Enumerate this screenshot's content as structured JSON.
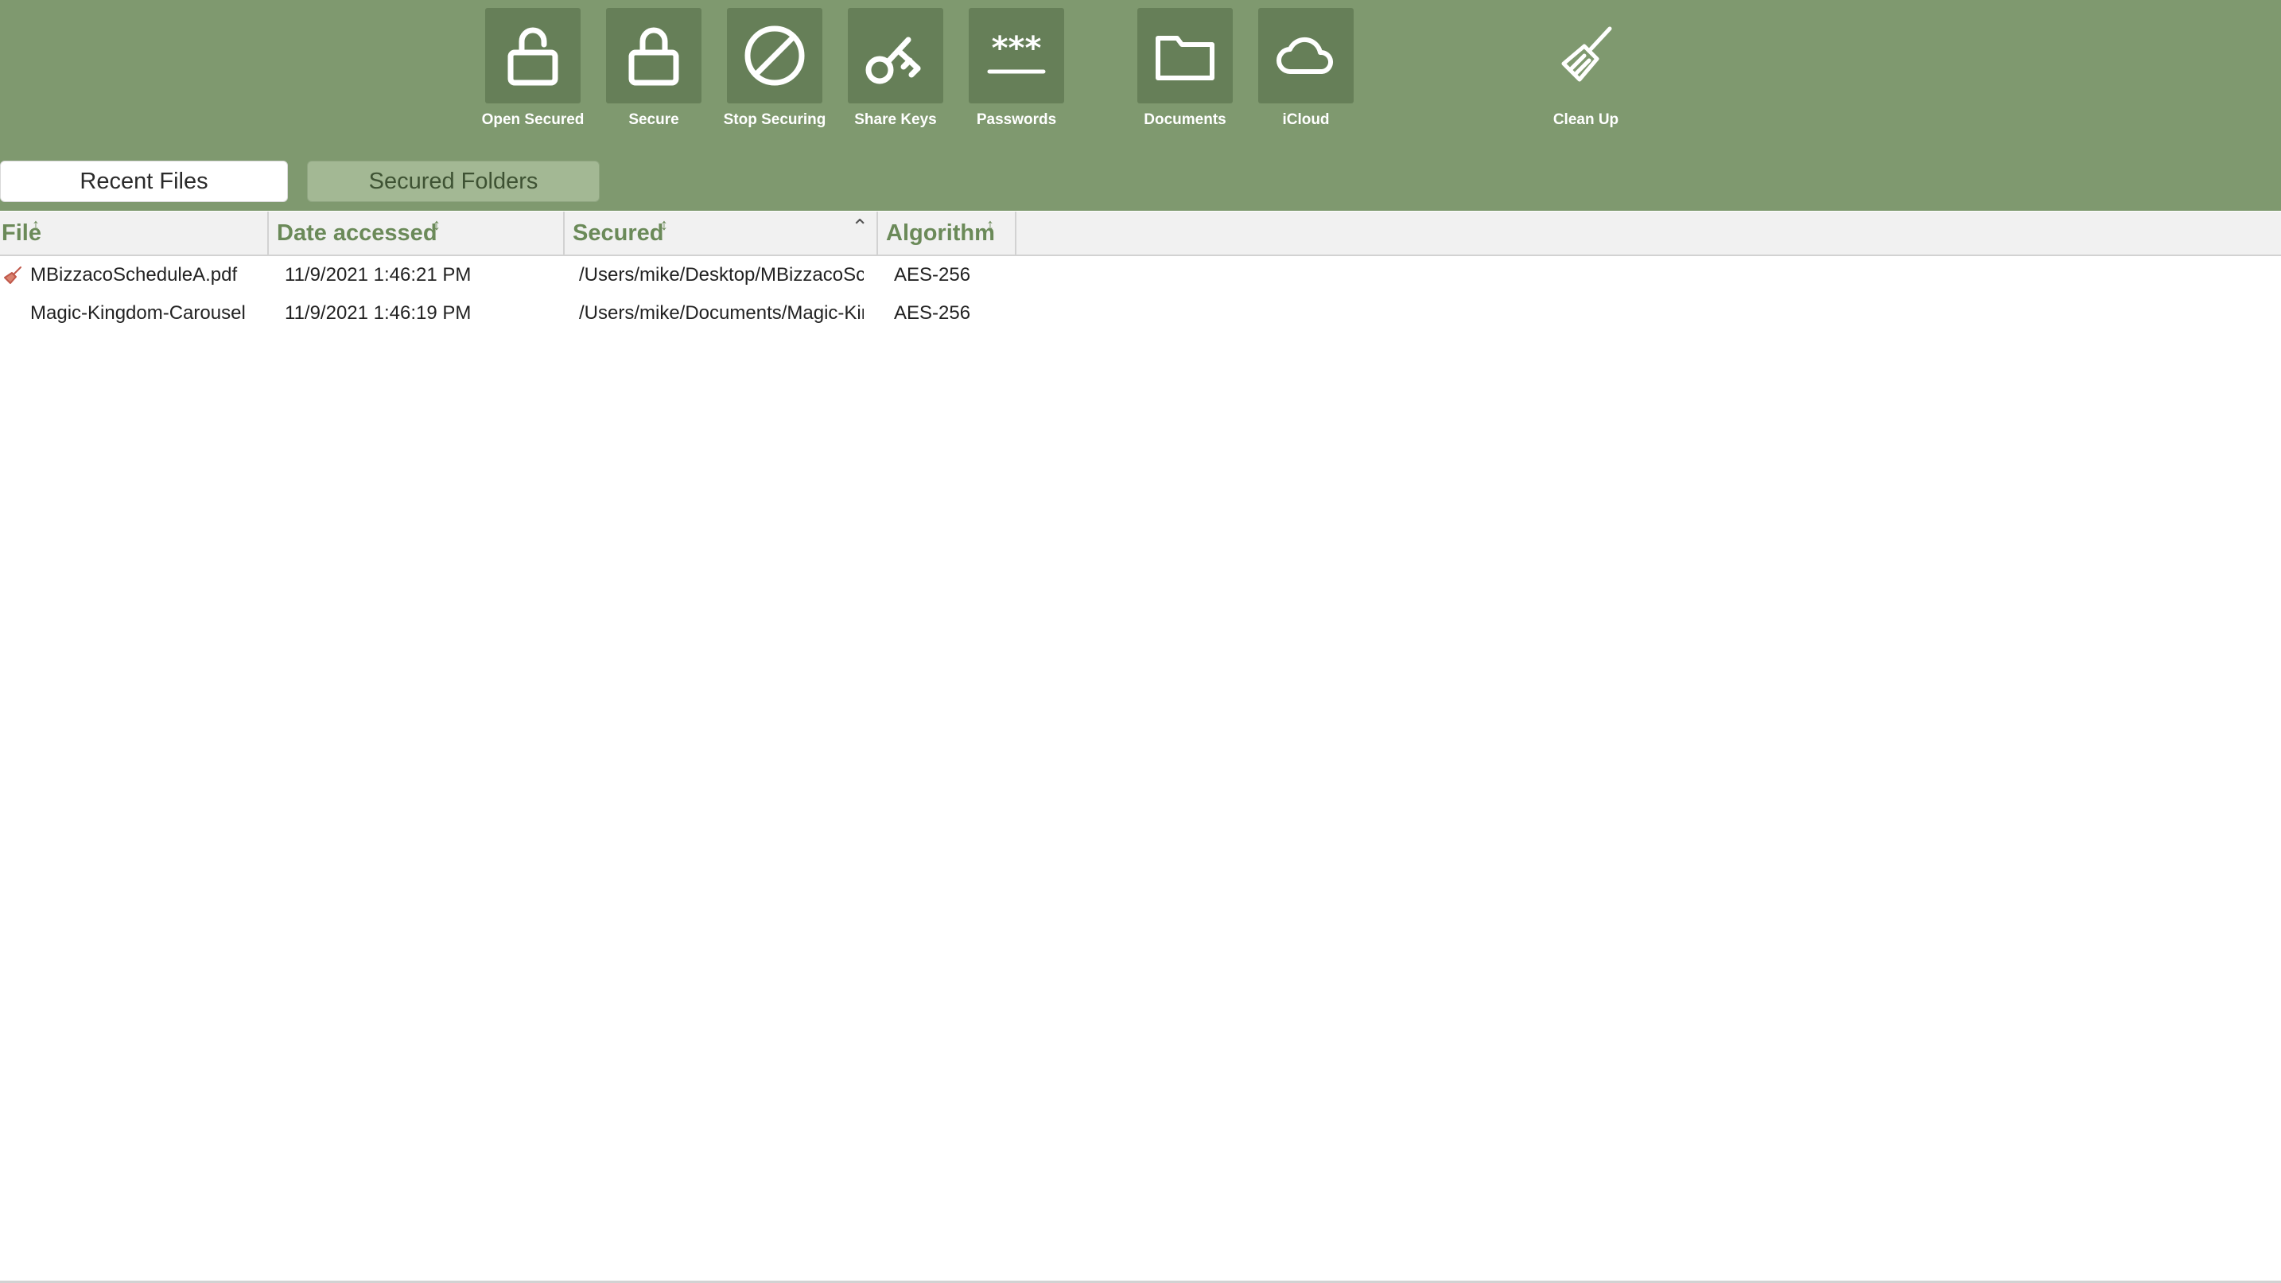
{
  "toolbar": {
    "buttons": [
      {
        "label": "Open Secured",
        "icon": "unlock-icon"
      },
      {
        "label": "Secure",
        "icon": "lock-icon"
      },
      {
        "label": "Stop Securing",
        "icon": "prohibited-icon"
      },
      {
        "label": "Share Keys",
        "icon": "key-icon"
      },
      {
        "label": "Passwords",
        "icon": "password-icon"
      },
      {
        "label": "Documents",
        "icon": "folder-icon"
      },
      {
        "label": "iCloud",
        "icon": "cloud-icon"
      },
      {
        "label": "Clean Up",
        "icon": "broom-icon"
      }
    ]
  },
  "tabs": [
    {
      "label": "Recent Files",
      "active": true
    },
    {
      "label": "Secured Folders",
      "active": false
    }
  ],
  "table": {
    "columns": [
      "File",
      "Date accessed",
      "Secured",
      "Algorithm"
    ],
    "rows": [
      {
        "file": "MBizzacoScheduleA.pdf",
        "date": "11/9/2021 1:46:21 PM",
        "secured": "/Users/mike/Desktop/MBizzacoScheduleA.pdf",
        "algorithm": "AES-256",
        "icon": "broom-icon"
      },
      {
        "file": "Magic-Kingdom-Carousel",
        "date": "11/9/2021 1:46:19 PM",
        "secured": "/Users/mike/Documents/Magic-Kingdom-Carousel",
        "algorithm": "AES-256"
      }
    ]
  },
  "colors": {
    "toolbar_bg": "#7f996f",
    "button_bg": "#667f58",
    "header_text": "#6b8a59",
    "inactive_tab_bg": "#a3b894"
  }
}
